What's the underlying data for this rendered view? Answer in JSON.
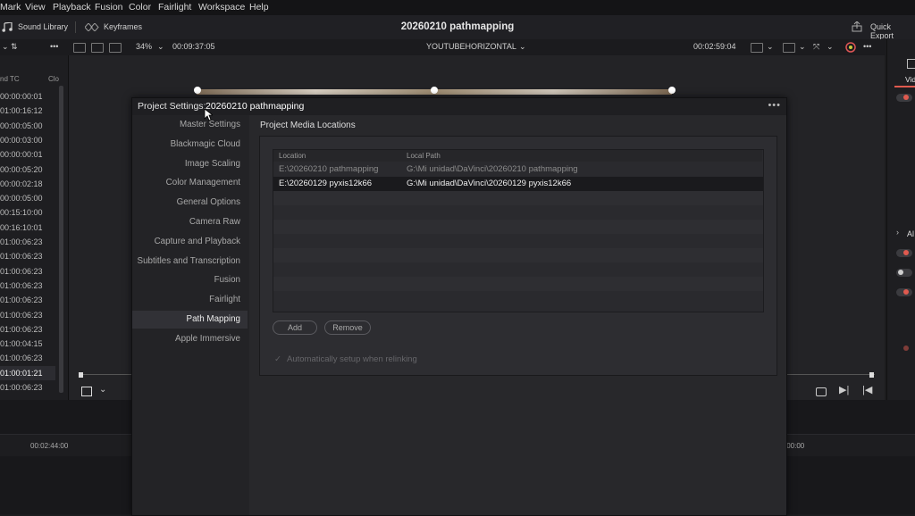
{
  "menu": [
    "Mark",
    "View",
    "Playback",
    "Fusion",
    "Color",
    "Fairlight",
    "Workspace",
    "Help"
  ],
  "toolbar": {
    "sound_library": "Sound Library",
    "keyframes": "Keyframes",
    "project_title": "20260210 pathmapping",
    "quick_export": "Quick Export"
  },
  "viewerbar": {
    "zoom": "34%",
    "timecode_left": "00:09:37:05",
    "timeline_name": "YOUTUBEHORIZONTAL",
    "timecode_right": "00:02:59:04"
  },
  "mediapool": {
    "col_start_tc": "nd TC",
    "col_clip": "Clo",
    "timecodes": [
      "00:00:00:01",
      "01:00:16:12",
      "00:00:05:00",
      "00:00:03:00",
      "00:00:00:01",
      "00:00:05:20",
      "00:00:02:18",
      "00:00:05:00",
      "00:15:10:00",
      "00:16:10:01",
      "01:00:06:23",
      "01:00:06:23",
      "01:00:06:23",
      "01:00:06:23",
      "01:00:06:23",
      "01:00:06:23",
      "01:00:06:23",
      "01:00:04:15",
      "01:00:06:23",
      "01:00:01:21",
      "01:00:06:23"
    ],
    "selected_index": 19
  },
  "inspector": {
    "tab_video": "Vid",
    "section_label": "Al"
  },
  "timeline": {
    "ruler_left": "00:02:44:00",
    "ruler_right": ":00:00"
  },
  "dialog": {
    "title_label": "Project Settings:",
    "project_name": "20260210 pathmapping",
    "more_glyph": "•••",
    "nav_items": [
      "Master Settings",
      "Blackmagic Cloud",
      "Image Scaling",
      "Color Management",
      "General Options",
      "Camera Raw",
      "Capture and Playback",
      "Subtitles and Transcription",
      "Fusion",
      "Fairlight",
      "Path Mapping",
      "Apple Immersive"
    ],
    "active_nav_index": 10,
    "panel_title": "Project Media Locations",
    "table": {
      "headers": [
        "Location",
        "Local Path"
      ],
      "rows": [
        [
          "E:\\20260210 pathmapping",
          "G:\\Mi unidad\\DaVinci\\20260210 pathmapping"
        ],
        [
          "E:\\20260129 pyxis12k66",
          "G:\\Mi unidad\\DaVinci\\20260129 pyxis12k66"
        ]
      ]
    },
    "add_button": "Add",
    "remove_button": "Remove",
    "auto_setup_checked": true,
    "auto_setup_label": "Automatically setup when relinking"
  },
  "colors": {
    "accent_red": "#e05a4f",
    "background": "#1c1c1e",
    "dialog_bg": "#28282b"
  }
}
